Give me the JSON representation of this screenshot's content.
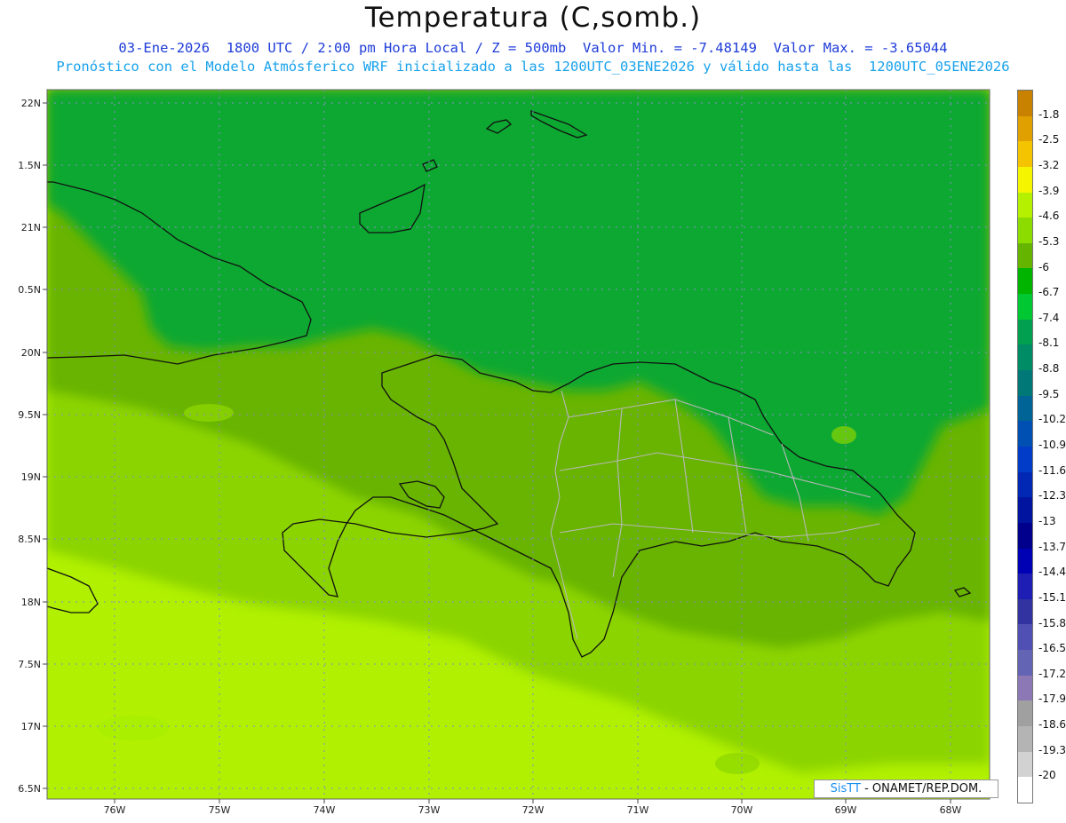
{
  "title": "Temperatura (C,somb.)",
  "subtitle_1": "03-Ene-2026  1800 UTC / 2:00 pm Hora Local / Z = 500mb  Valor Min. = -7.48149  Valor Max. = -3.65044",
  "subtitle_2": "Pronóstico con el Modelo Atmósferico WRF inicializado a las 1200UTC_03ENE2026 y válido hasta las  1200UTC_05ENE2026",
  "credit": {
    "brand": "SisTT",
    "text": "- ONAMET/REP.DOM."
  },
  "axes": {
    "lat_labels": [
      "22N",
      "1.5N",
      "21N",
      "0.5N",
      "20N",
      "9.5N",
      "19N",
      "8.5N",
      "18N",
      "7.5N",
      "17N",
      "6.5N"
    ],
    "lon_labels": [
      "76W",
      "75W",
      "74W",
      "73W",
      "72W",
      "71W",
      "70W",
      "69W",
      "68W"
    ]
  },
  "colorbar": {
    "labels": [
      "-1.8",
      "-2.5",
      "-3.2",
      "-3.9",
      "-4.6",
      "-5.3",
      "-6",
      "-6.7",
      "-7.4",
      "-8.1",
      "-8.8",
      "-9.5",
      "-10.2",
      "-10.9",
      "-11.6",
      "-12.3",
      "-13",
      "-13.7",
      "-14.4",
      "-15.1",
      "-15.8",
      "-16.5",
      "-17.2",
      "-17.9",
      "-18.6",
      "-19.3",
      "-20"
    ],
    "colors": [
      "#c88200",
      "#e0a000",
      "#f5c400",
      "#f5f500",
      "#b4f000",
      "#8cdc00",
      "#64b400",
      "#00b400",
      "#00c832",
      "#00a050",
      "#008c64",
      "#007878",
      "#006496",
      "#0050b4",
      "#003cc8",
      "#0028b4",
      "#0014a0",
      "#00008c",
      "#0000b4",
      "#1e1eb4",
      "#3232a0",
      "#5050b4",
      "#6464b4",
      "#8c78b4",
      "#a0a0a0",
      "#b4b4b4",
      "#d2d2d2",
      "#ffffff"
    ]
  },
  "field_colors": {
    "north_sea": "#10a830",
    "mid_band": "#68b400",
    "south_band": "#8cd400",
    "far_south": "#b0f000"
  }
}
